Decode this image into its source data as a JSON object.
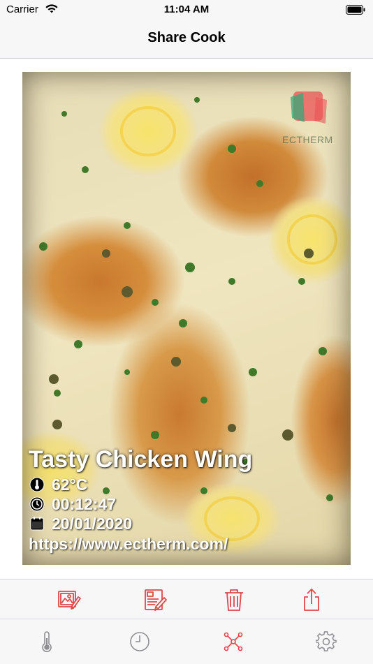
{
  "status_bar": {
    "carrier": "Carrier",
    "time": "11:04 AM"
  },
  "nav": {
    "title": "Share Cook"
  },
  "photo": {
    "subject": "pan-seared chicken with lemon slices, capers and parsley in cream sauce",
    "watermark_text": "ECTHERM",
    "overlay": {
      "title": "Tasty Chicken Wing",
      "temperature": "62°C",
      "duration": "00:12:47",
      "date": "20/01/2020",
      "url": "https://www.ectherm.com/"
    }
  },
  "toolbar": {
    "accent_color": "#e0474c",
    "buttons": [
      {
        "icon": "edit-photo-icon"
      },
      {
        "icon": "edit-note-icon"
      },
      {
        "icon": "trash-icon"
      },
      {
        "icon": "share-icon"
      }
    ]
  },
  "tab_bar": {
    "inactive_color": "#8e8e93",
    "active_color": "#e0474c",
    "tabs": [
      {
        "icon": "thermometer-icon",
        "active": false
      },
      {
        "icon": "clock-icon",
        "active": false
      },
      {
        "icon": "network-icon",
        "active": true
      },
      {
        "icon": "gear-icon",
        "active": false
      }
    ]
  }
}
